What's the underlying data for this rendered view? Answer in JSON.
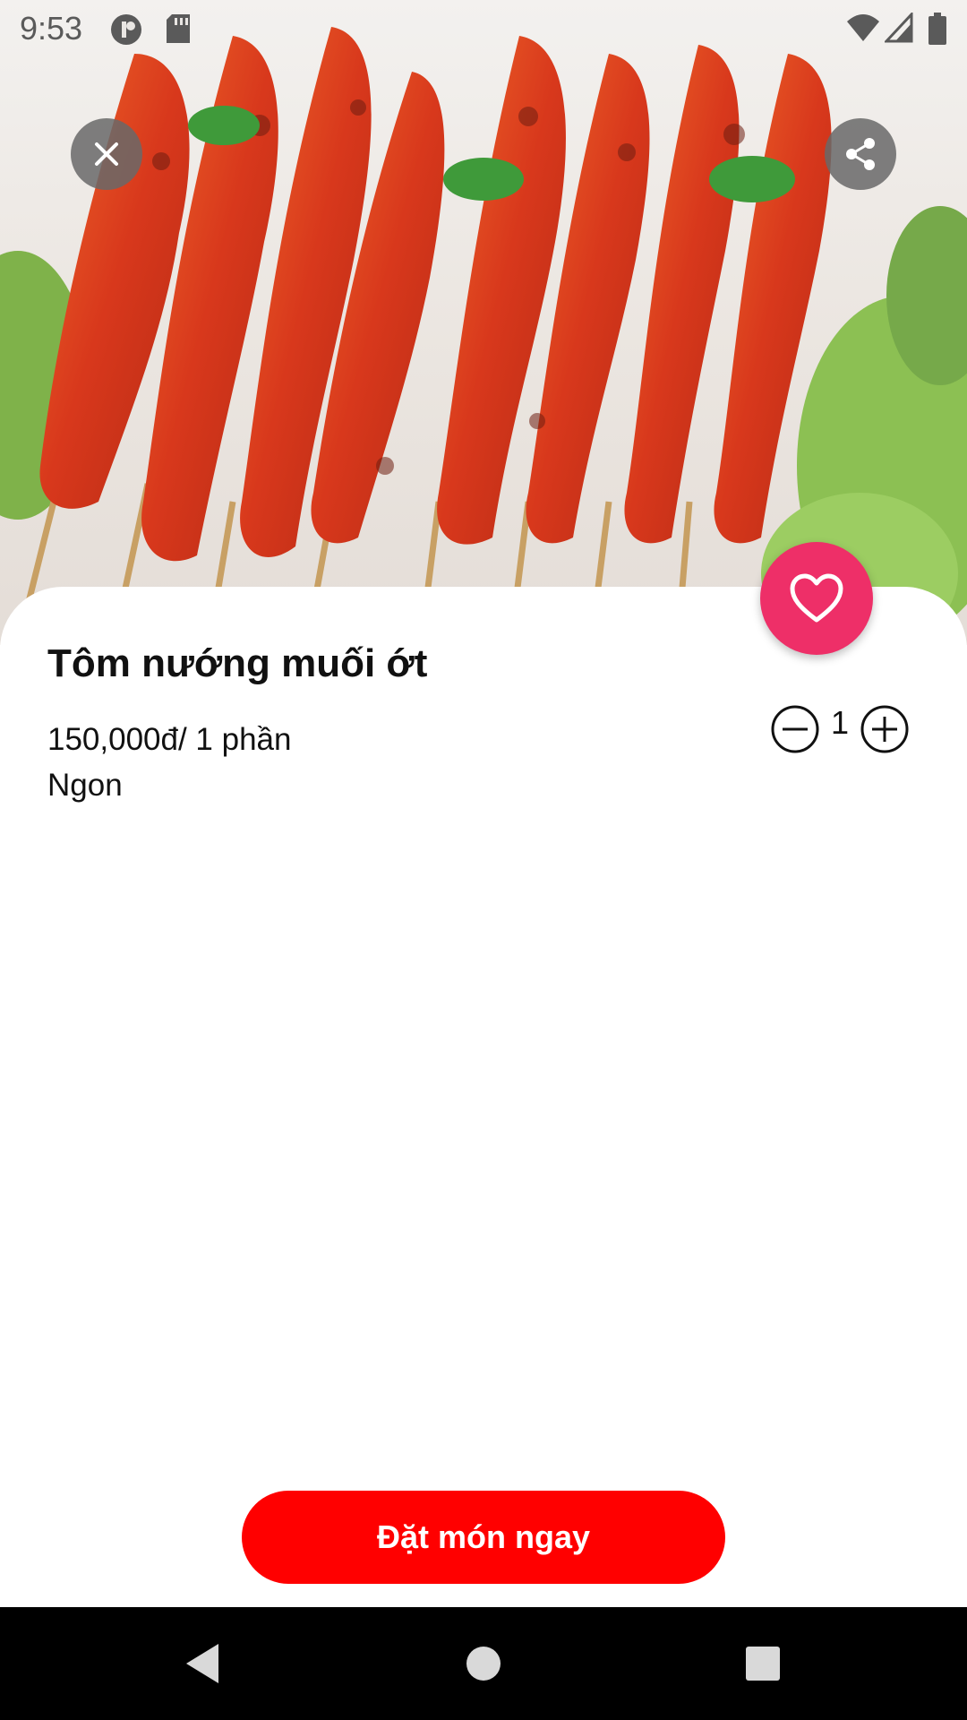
{
  "status_bar": {
    "time": "9:53",
    "left_icons": [
      "app-notification-icon",
      "sd-card-icon"
    ],
    "right_icons": [
      "wifi-icon",
      "cellular-signal-icon",
      "battery-icon"
    ]
  },
  "hero": {
    "image": "grilled-shrimp-skewers-photo",
    "close_icon": "close-icon",
    "share_icon": "share-icon"
  },
  "favorite": {
    "icon": "heart-icon",
    "color": "#ee2f68"
  },
  "product": {
    "name": "Tôm nướng muối ớt",
    "price": "150,000đ/ 1 phần",
    "description": "Ngon"
  },
  "quantity": {
    "value": "1",
    "decrease_icon": "minus-circle-icon",
    "increase_icon": "plus-circle-icon"
  },
  "order_button": {
    "label": "Đặt món ngay",
    "color": "#ff0000"
  },
  "nav_bar": {
    "icons": [
      "back-icon",
      "home-icon",
      "recents-icon"
    ]
  }
}
